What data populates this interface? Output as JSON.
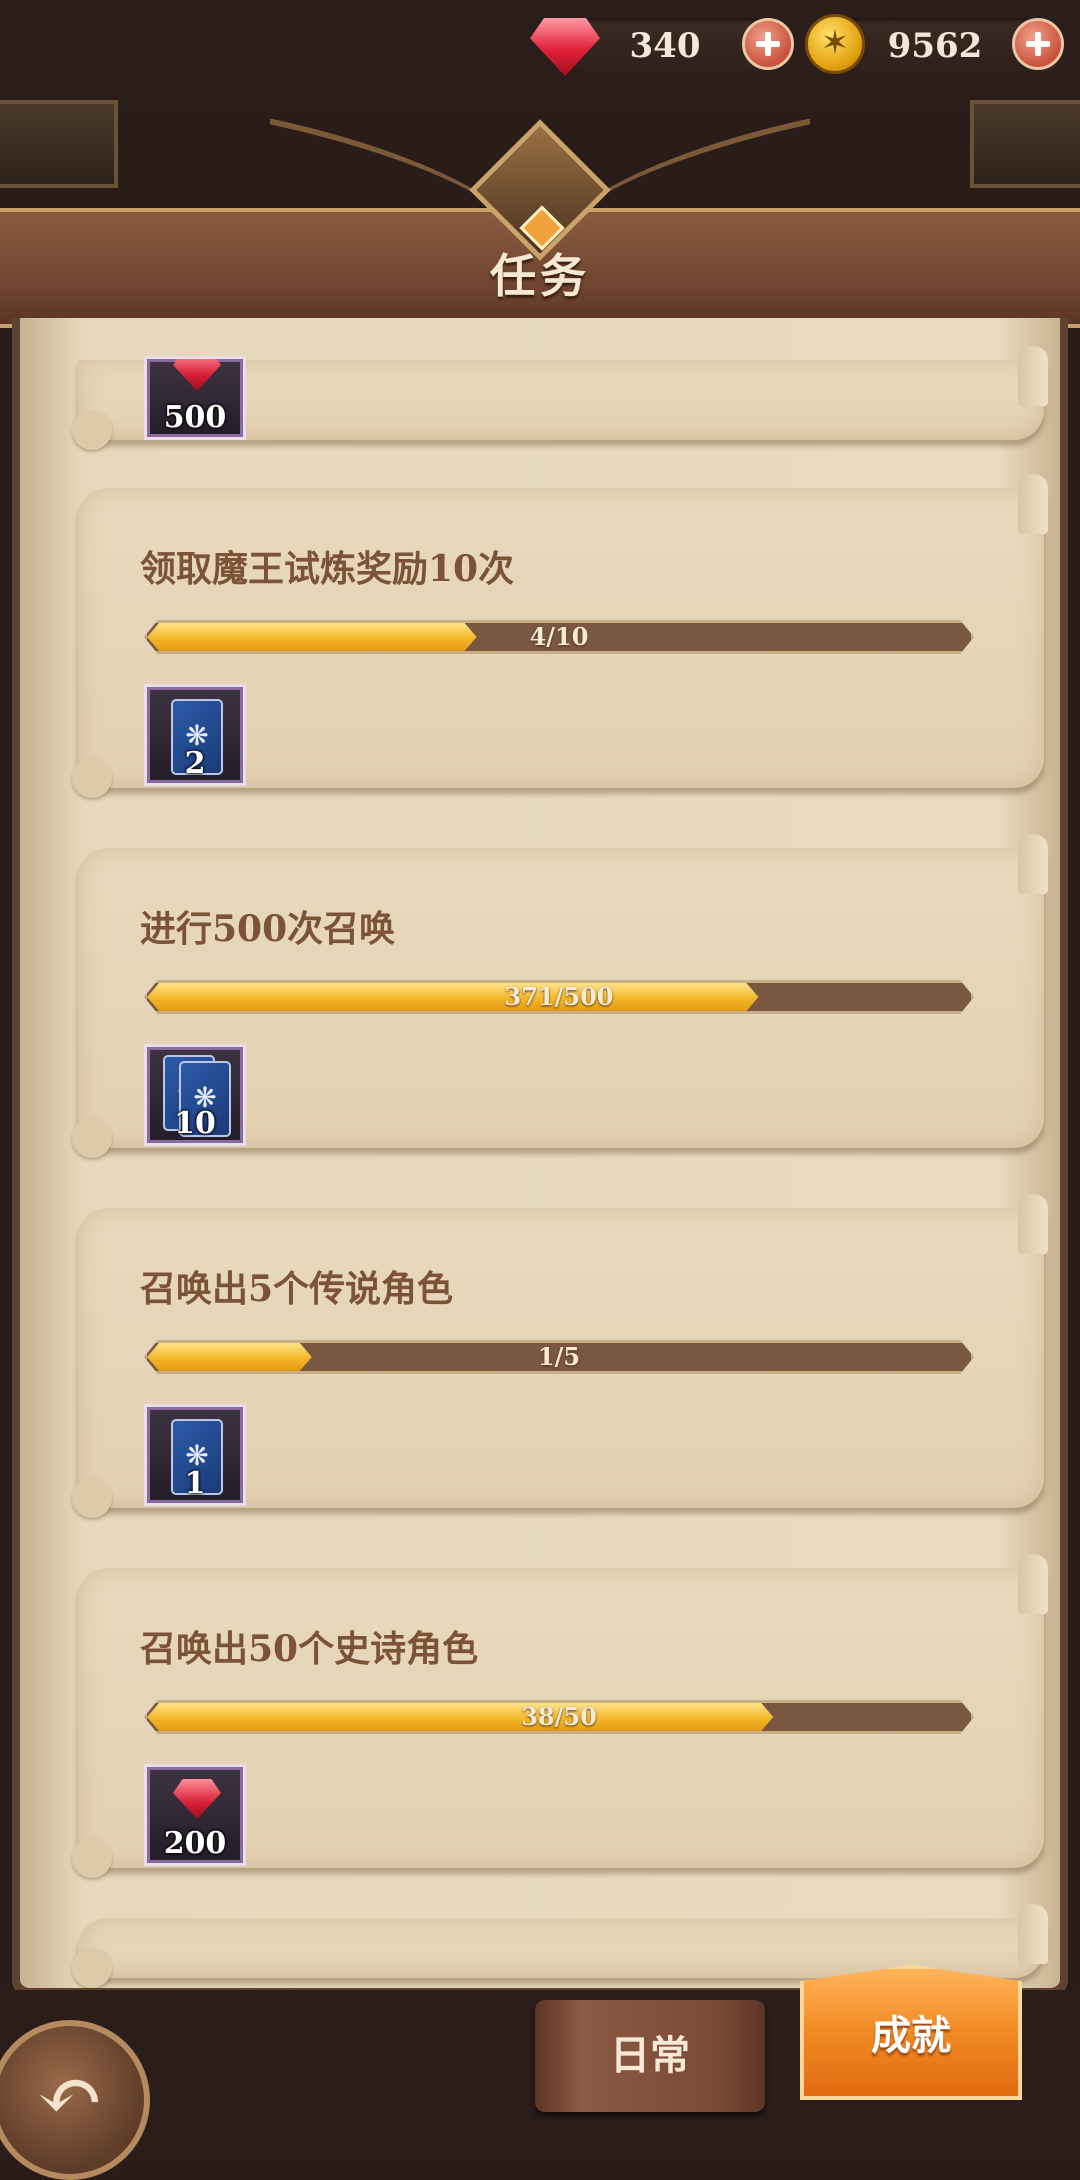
{
  "currency": {
    "gems": "340",
    "gold": "9562"
  },
  "header": {
    "title": "任务"
  },
  "tasks": [
    {
      "title": "",
      "progress_text": "",
      "progress": null,
      "reward": {
        "type": "gem",
        "count": "500"
      }
    },
    {
      "title": "领取魔王试炼奖励10次",
      "progress_text": "4/10",
      "progress": 0.4,
      "reward": {
        "type": "card",
        "count": "2"
      }
    },
    {
      "title": "进行500次召唤",
      "progress_text": "371/500",
      "progress": 0.742,
      "reward": {
        "type": "card",
        "count": "10"
      }
    },
    {
      "title": "召唤出5个传说角色",
      "progress_text": "1/5",
      "progress": 0.2,
      "reward": {
        "type": "card",
        "count": "1"
      }
    },
    {
      "title": "召唤出50个史诗角色",
      "progress_text": "38/50",
      "progress": 0.76,
      "reward": {
        "type": "gem",
        "count": "200"
      }
    }
  ],
  "tabs": {
    "daily": "日常",
    "achievement": "成就"
  },
  "colors": {
    "progress_fill": "#f3b72a",
    "progress_track": "#7a5741",
    "active_tab": "#f28a24"
  },
  "icons": {
    "gem": "red-gem-icon",
    "gold": "gold-coin-icon",
    "card": "summon-card-icon",
    "back": "back-arrow-icon"
  }
}
